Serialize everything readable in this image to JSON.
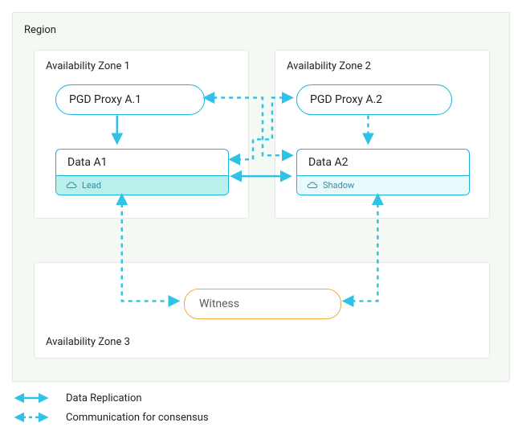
{
  "region": {
    "label": "Region"
  },
  "az1": {
    "label": "Availability Zone 1",
    "proxy": "PGD Proxy A.1",
    "data_label": "Data A1",
    "role": "Lead"
  },
  "az2": {
    "label": "Availability Zone 2",
    "proxy": "PGD Proxy A.2",
    "data_label": "Data A2",
    "role": "Shadow"
  },
  "az3": {
    "label": "Availability Zone 3",
    "witness": "Witness"
  },
  "legend": {
    "replication": "Data Replication",
    "consensus": "Communication for consensus"
  }
}
